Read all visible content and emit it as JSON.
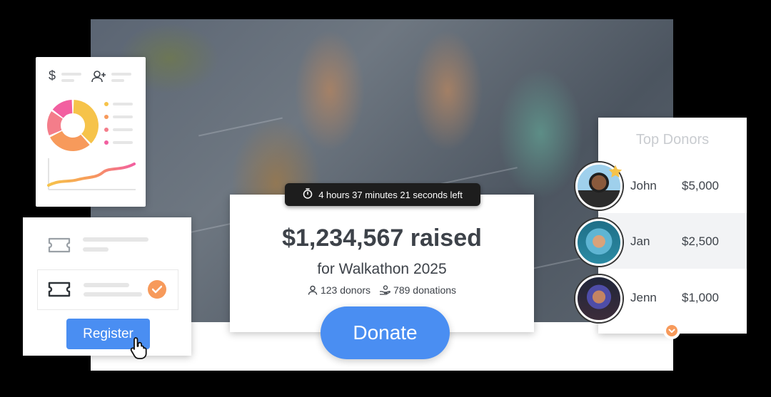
{
  "timer": {
    "text": "4 hours 37 minutes 21 seconds left"
  },
  "campaign": {
    "raised": "$1,234,567 raised",
    "event": "for Walkathon 2025",
    "donors": "123 donors",
    "donations": "789 donations",
    "donate_label": "Donate"
  },
  "register": {
    "button_label": "Register"
  },
  "top_donors": {
    "title": "Top Donors",
    "items": [
      {
        "name": "John",
        "amount": "$5,000"
      },
      {
        "name": "Jan",
        "amount": "$2,500"
      },
      {
        "name": "Jenn",
        "amount": "$1,000"
      }
    ]
  },
  "analytics": {
    "dollar_icon": "$",
    "donut": [
      {
        "color": "#f6c34a",
        "fraction": 0.38
      },
      {
        "color": "#f79a5b",
        "fraction": 0.3
      },
      {
        "color": "#f47d8a",
        "fraction": 0.17
      },
      {
        "color": "#f25fa0",
        "fraction": 0.15
      }
    ],
    "legend_colors": [
      "#f6c34a",
      "#f79a5b",
      "#f47d8a",
      "#f25fa0"
    ]
  },
  "colors": {
    "accent": "#4a8ef2",
    "check": "#f79a5b"
  }
}
